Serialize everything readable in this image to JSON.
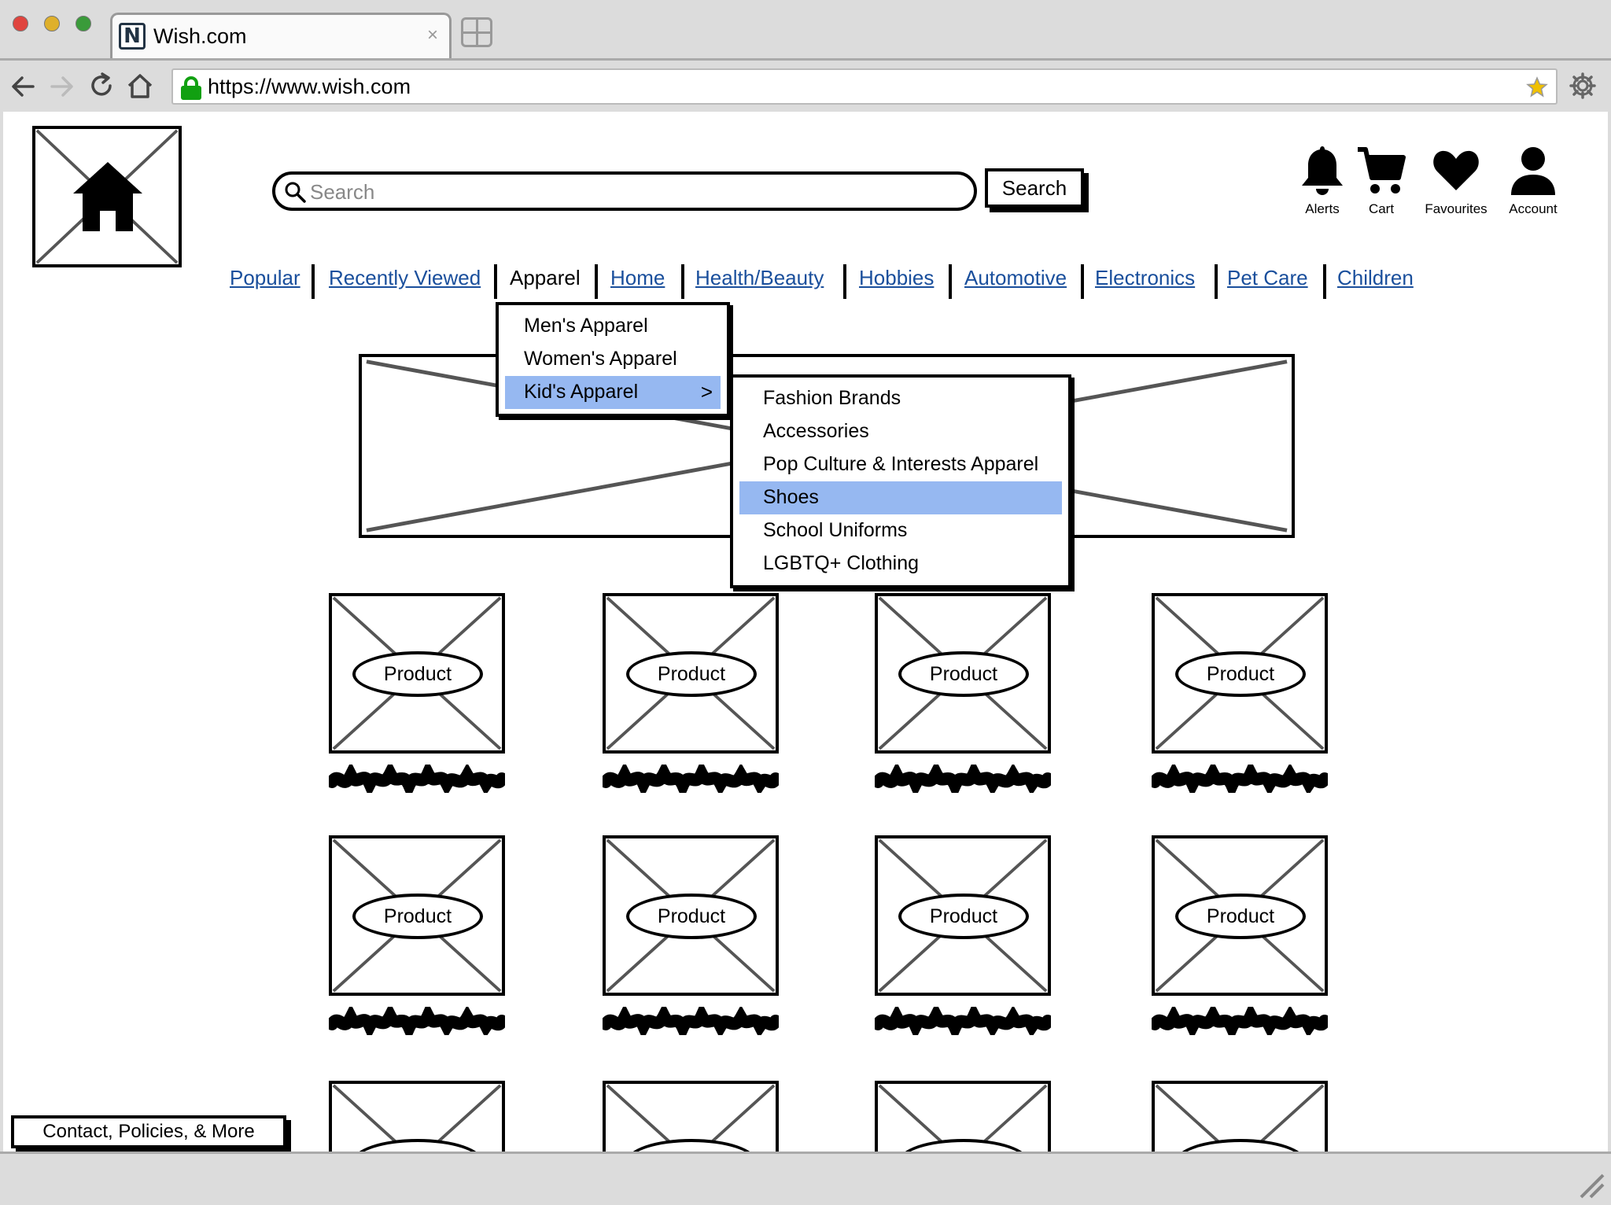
{
  "browser": {
    "tab_title": "Wish.com",
    "tab_favicon": "N",
    "tab_close": "×",
    "url": "https://www.wish.com",
    "icons": [
      "back-arrow-icon",
      "forward-arrow-icon",
      "reload-icon",
      "home-icon",
      "lock-icon",
      "bookmark-star-icon",
      "settings-gear-icon",
      "new-tab-icon"
    ]
  },
  "header": {
    "search": {
      "placeholder": "Search",
      "button_label": "Search"
    },
    "icons": [
      {
        "name": "bell-icon",
        "label": "Alerts"
      },
      {
        "name": "cart-icon",
        "label": "Cart"
      },
      {
        "name": "heart-icon",
        "label": "Favourites"
      },
      {
        "name": "user-icon",
        "label": "Account"
      }
    ]
  },
  "categories": [
    "Popular",
    "Recently Viewed",
    "Apparel",
    "Home",
    "Health/Beauty",
    "Hobbies",
    "Automotive",
    "Electronics",
    "Pet Care",
    "Children"
  ],
  "active_category": "Apparel",
  "apparel_menu": {
    "items": [
      "Men's Apparel",
      "Women's Apparel",
      "Kid's Apparel"
    ],
    "selected": "Kid's Apparel",
    "submenu_indicator": ">"
  },
  "kids_submenu": {
    "items": [
      "Fashion Brands",
      "Accessories",
      "Pop Culture & Interests Apparel",
      "Shoes",
      "School Uniforms",
      "LGBTQ+ Clothing"
    ],
    "selected": "Shoes"
  },
  "products": {
    "label": "Product",
    "rows_visible": 3,
    "per_row": 4
  },
  "footer": {
    "button_label": "Contact, Policies, & More"
  },
  "colors": {
    "link": "#1a4f9c",
    "menu_highlight": "#96b8f1",
    "lock": "#11a011",
    "bookmark": "#e8b800"
  }
}
